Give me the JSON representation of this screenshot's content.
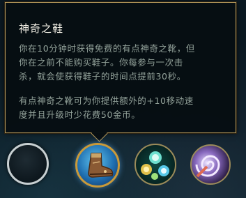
{
  "tooltip": {
    "title": "神奇之鞋",
    "lines1": [
      "你在10分钟时获得免费的有点神奇之靴，但",
      "你在之前不能购买鞋子。你每参与一次击",
      "杀，就会使获得鞋子的时间点提前30秒。"
    ],
    "lines2": [
      "有点神奇之靴可为你提供额外的+10移动速",
      "度并且升级时少花费50金币。"
    ]
  },
  "slots": [
    {
      "icon": "empty-slot-icon"
    },
    {
      "icon": "magical-footwear-icon",
      "selected": true
    },
    {
      "icon": "orbs-icon"
    },
    {
      "icon": "spiral-icon"
    }
  ],
  "colors": {
    "tooltip_border": "#b89a5a",
    "title": "#f3f0e6",
    "desc": "#93a29a",
    "selected_ring": "#c99a3a"
  }
}
